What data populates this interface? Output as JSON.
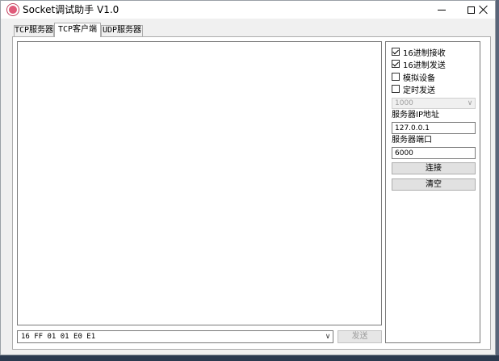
{
  "window": {
    "title": "Socket调试助手 V1.0"
  },
  "tabs": [
    {
      "label": "TCP服务器"
    },
    {
      "label": "TCP客户端"
    },
    {
      "label": "UDP服务器"
    }
  ],
  "send": {
    "value": "16 FF 01 01 E0 E1",
    "button_label": "发送"
  },
  "options": {
    "hex_receive": {
      "label": "16进制接收",
      "checked": true
    },
    "hex_send": {
      "label": "16进制发送",
      "checked": true
    },
    "simulate_device": {
      "label": "模拟设备",
      "checked": false
    },
    "timed_send": {
      "label": "定时发送",
      "checked": false
    },
    "interval_value": "1000"
  },
  "connection": {
    "server_ip_label": "服务器IP地址",
    "server_ip_value": "127.0.0.1",
    "server_port_label": "服务器端口",
    "server_port_value": "6000",
    "connect_label": "连接",
    "clear_label": "清空"
  },
  "colors": {
    "window_bg": "#f0f0f0",
    "desktop_bg": "#6d7787",
    "disabled_text": "#9d9d9d"
  }
}
